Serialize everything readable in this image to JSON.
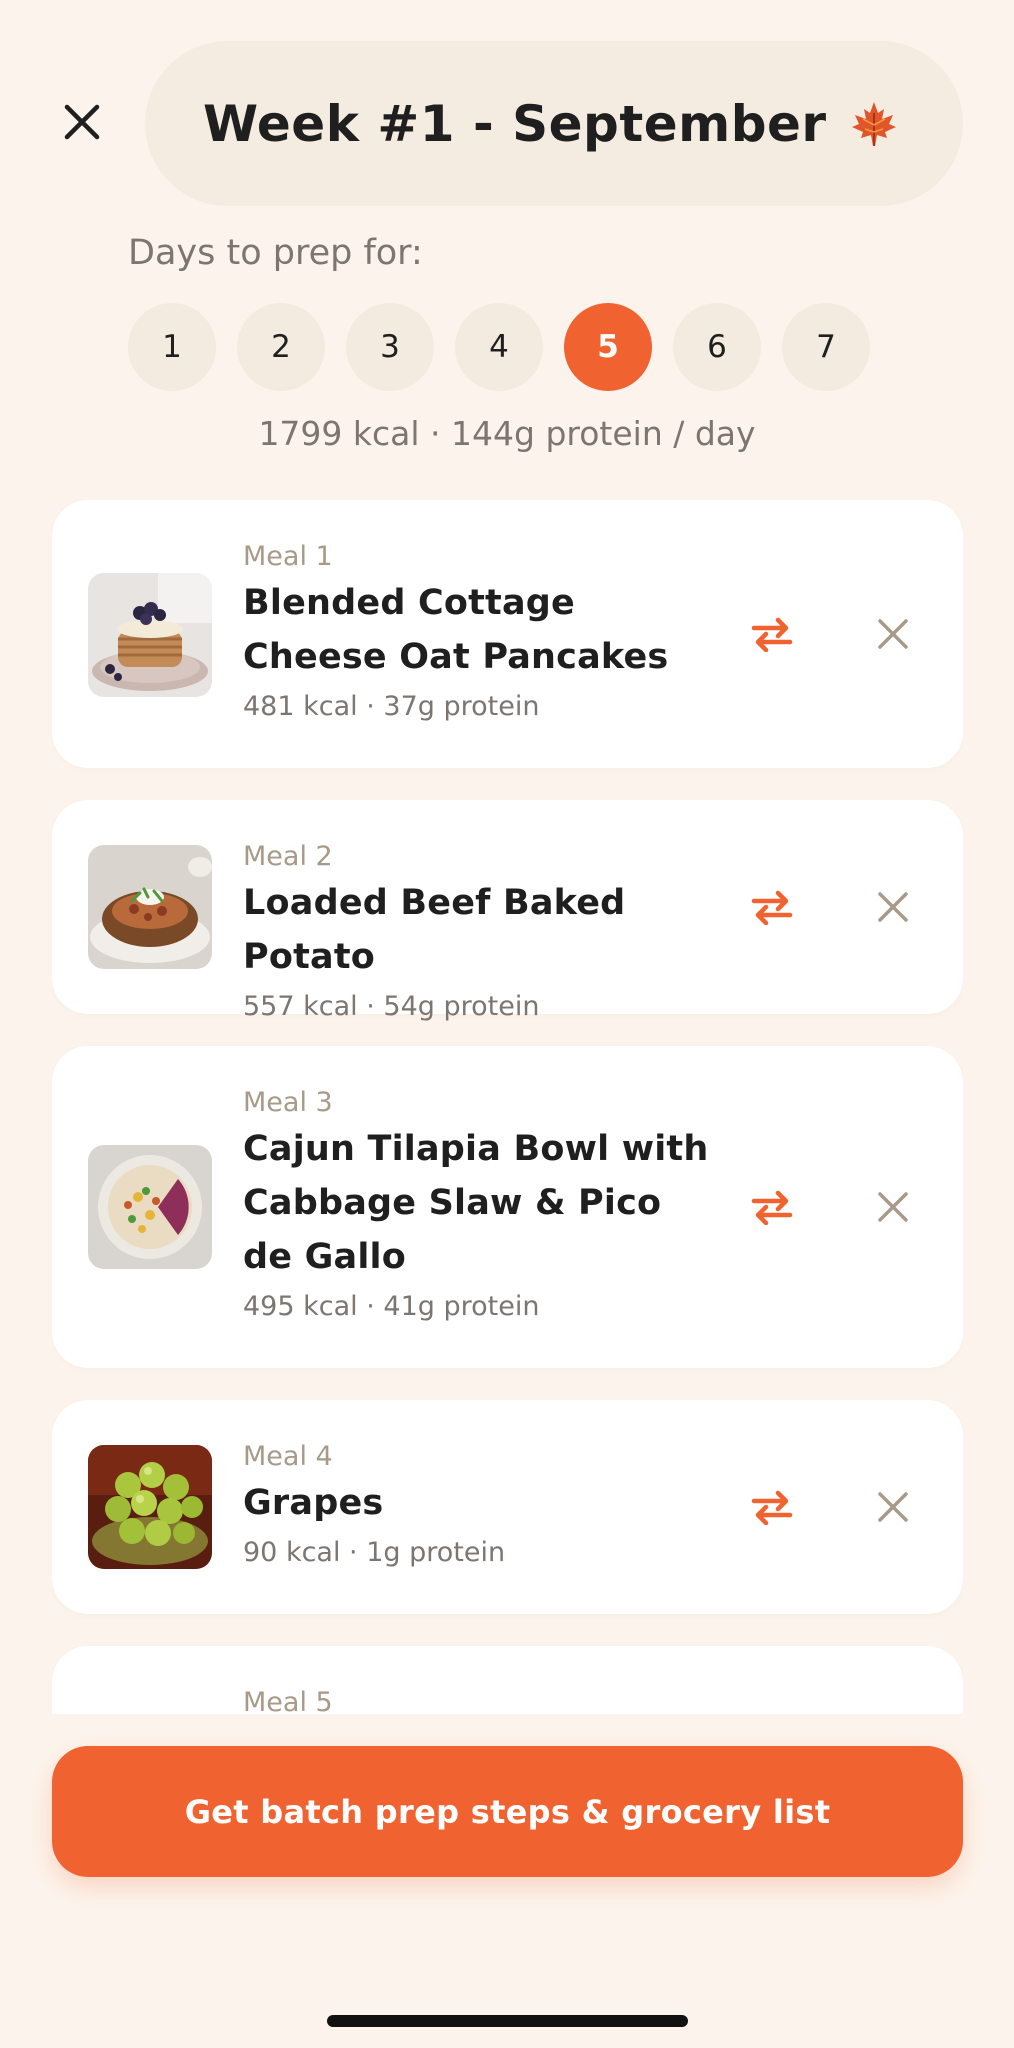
{
  "header": {
    "title": "Week #1 - September",
    "title_emoji": "maple-leaf-icon",
    "close_icon": "close-icon"
  },
  "days": {
    "label": "Days to prep for:",
    "options": [
      "1",
      "2",
      "3",
      "4",
      "5",
      "6",
      "7"
    ],
    "selected": "5"
  },
  "summary": "1799 kcal · 144g protein / day",
  "meals": [
    {
      "number": "Meal 1",
      "name": "Blended Cottage Cheese Oat Pancakes",
      "meta": "481 kcal · 37g protein",
      "image": "pancakes-photo"
    },
    {
      "number": "Meal 2",
      "name": "Loaded Beef Baked Potato",
      "meta": "557 kcal · 54g protein",
      "image": "baked-potato-photo"
    },
    {
      "number": "Meal 3",
      "name": "Cajun Tilapia Bowl with Cabbage Slaw & Pico de Gallo",
      "meta": "495 kcal · 41g protein",
      "image": "tilapia-bowl-photo"
    },
    {
      "number": "Meal 4",
      "name": "Grapes",
      "meta": "90 kcal · 1g protein",
      "image": "grapes-photo"
    },
    {
      "number": "Meal 5"
    }
  ],
  "cta_label": "Get batch prep steps & grocery list",
  "colors": {
    "accent": "#f0622f",
    "background": "#fcf4ec",
    "pill": "#f4ece1",
    "muted": "#7c7570"
  }
}
